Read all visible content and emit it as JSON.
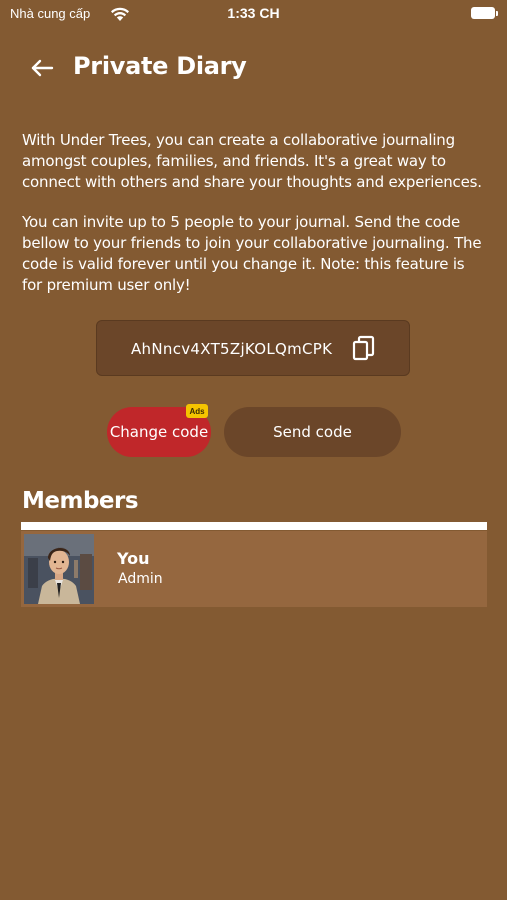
{
  "status_bar": {
    "carrier": "Nhà cung cấp",
    "time": "1:33 CH"
  },
  "header": {
    "title": "Private Diary",
    "back_icon": "arrow-left-icon"
  },
  "intro": {
    "paragraph1": "With Under Trees, you can create a collaborative journaling amongst couples, families, and friends. It's a great way to connect with others and share your thoughts and experiences.",
    "paragraph2": "You can invite up to 5 people to your journal. Send the code bellow to your friends to join your collaborative journaling. The code is valid forever until you change it. Note: this feature is for premium user only!"
  },
  "code": {
    "value": "AhNncv4XT5ZjKOLQmCPK",
    "copy_icon": "copy-icon"
  },
  "actions": {
    "change_code_label": "Change code",
    "ads_badge": "Ads",
    "send_code_label": "Send code"
  },
  "members": {
    "title": "Members",
    "items": [
      {
        "name": "You",
        "role": "Admin"
      }
    ]
  },
  "colors": {
    "background": "#835a32",
    "panel": "#6b4629",
    "change_button": "#c0272a",
    "member_row": "#95673f",
    "ads_badge": "#f5c400"
  }
}
